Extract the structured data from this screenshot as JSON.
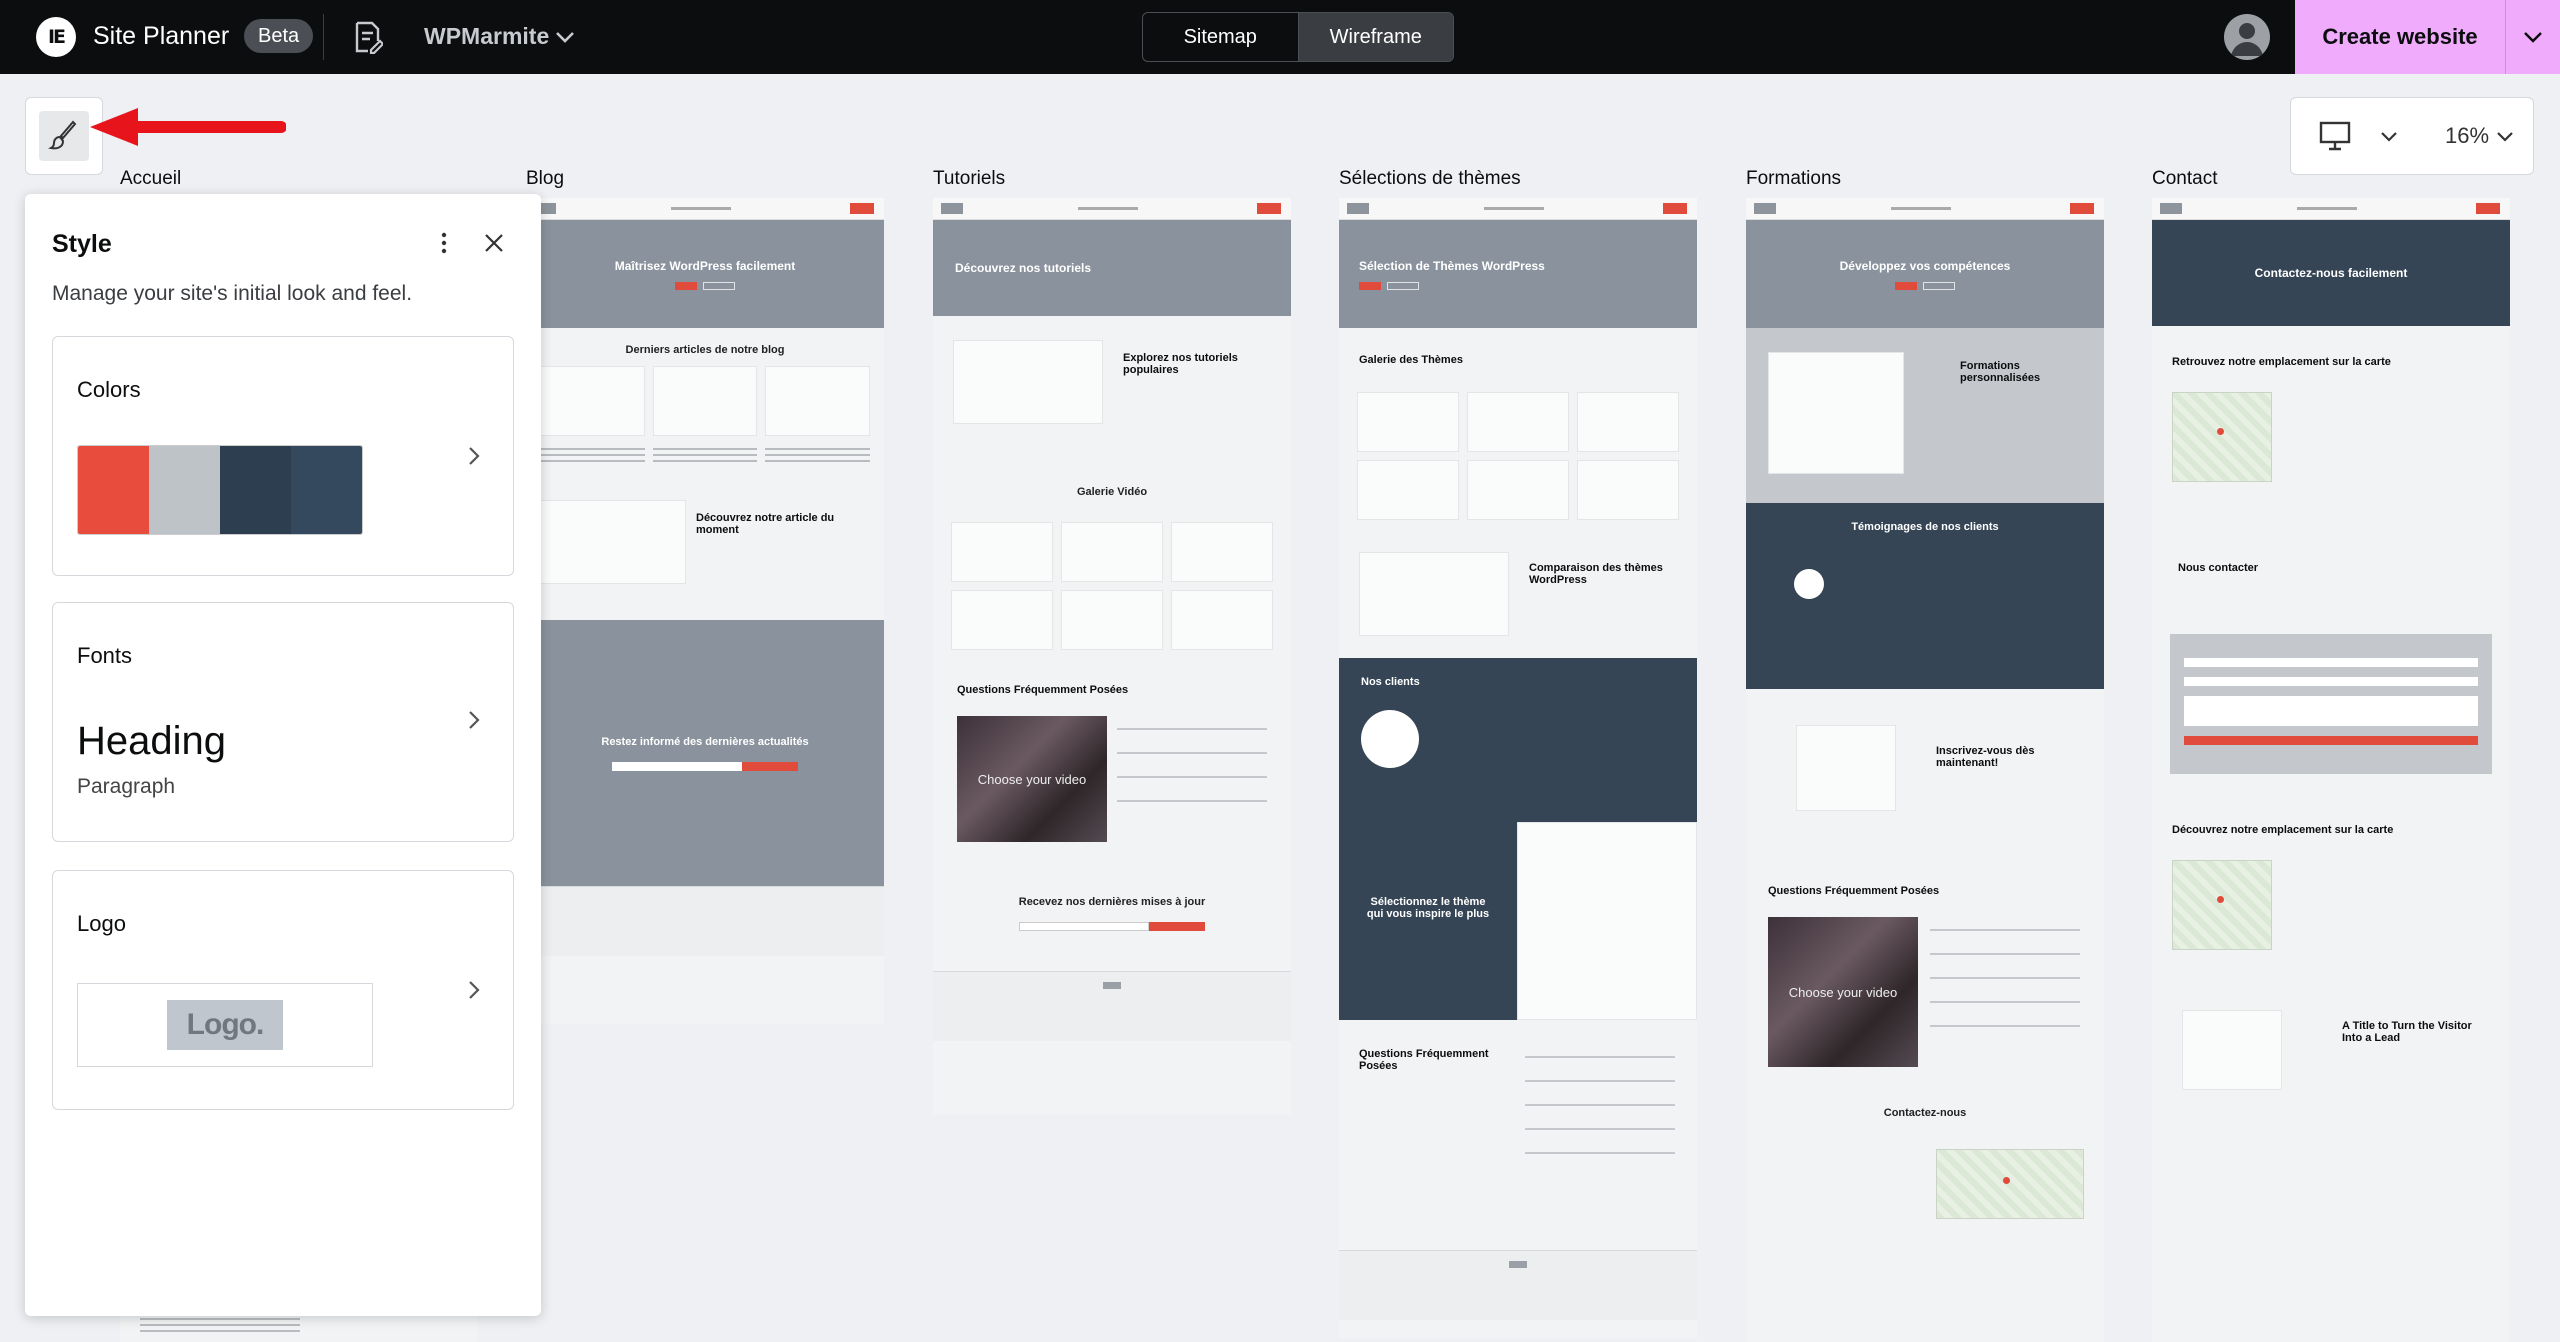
{
  "topbar": {
    "brand_name": "Site Planner",
    "badge": "Beta",
    "site_name": "WPMarmite",
    "views": [
      "Sitemap",
      "Wireframe"
    ],
    "active_view": "Wireframe",
    "create_label": "Create website"
  },
  "canvas": {
    "zoom": "16%",
    "pages": [
      "Accueil",
      "Blog",
      "Tutoriels",
      "Sélections de thèmes",
      "Formations",
      "Contact"
    ]
  },
  "wireframes": {
    "blog": {
      "hero_title": "Maîtrisez WordPress facilement",
      "section1": "Derniers articles de notre blog",
      "section2": "Découvrez notre article du moment",
      "newsletter": "Restez informé des dernières actualités"
    },
    "tutoriels": {
      "hero_title": "Découvrez nos tutoriels",
      "section1": "Explorez nos tutoriels populaires",
      "section2": "Galerie Vidéo",
      "section3": "Questions Fréquemment Posées",
      "video": "Choose your video",
      "newsletter": "Recevez nos dernières mises à jour"
    },
    "themes": {
      "hero_title": "Sélection de Thèmes WordPress",
      "section1": "Galerie des Thèmes",
      "section2": "Comparaison des thèmes WordPress",
      "section3": "Nos clients",
      "section4": "Sélectionnez le thème qui vous inspire le plus",
      "section5": "Questions Fréquemment Posées"
    },
    "formations": {
      "hero_title": "Développez vos compétences",
      "section1": "Formations personnalisées",
      "section2": "Témoignages de nos clients",
      "section3": "Inscrivez-vous dès maintenant!",
      "section4": "Questions Fréquemment Posées",
      "video": "Choose your video",
      "section5": "Contactez-nous"
    },
    "contact": {
      "hero_title": "Contactez-nous facilement",
      "section1": "Retrouvez notre emplacement sur la carte",
      "section2": "Nous contacter",
      "section3": "Découvrez notre emplacement sur la carte",
      "section4": "A Title to Turn the Visitor Into a Lead"
    }
  },
  "style_panel": {
    "title": "Style",
    "description": "Manage your site's initial look and feel.",
    "colors_label": "Colors",
    "colors": [
      "#e74c3c",
      "#bdc3c7",
      "#2c3e50",
      "#34495e"
    ],
    "fonts_label": "Fonts",
    "heading_sample": "Heading",
    "paragraph_sample": "Paragraph",
    "logo_label": "Logo",
    "logo_sample": "Logo."
  }
}
